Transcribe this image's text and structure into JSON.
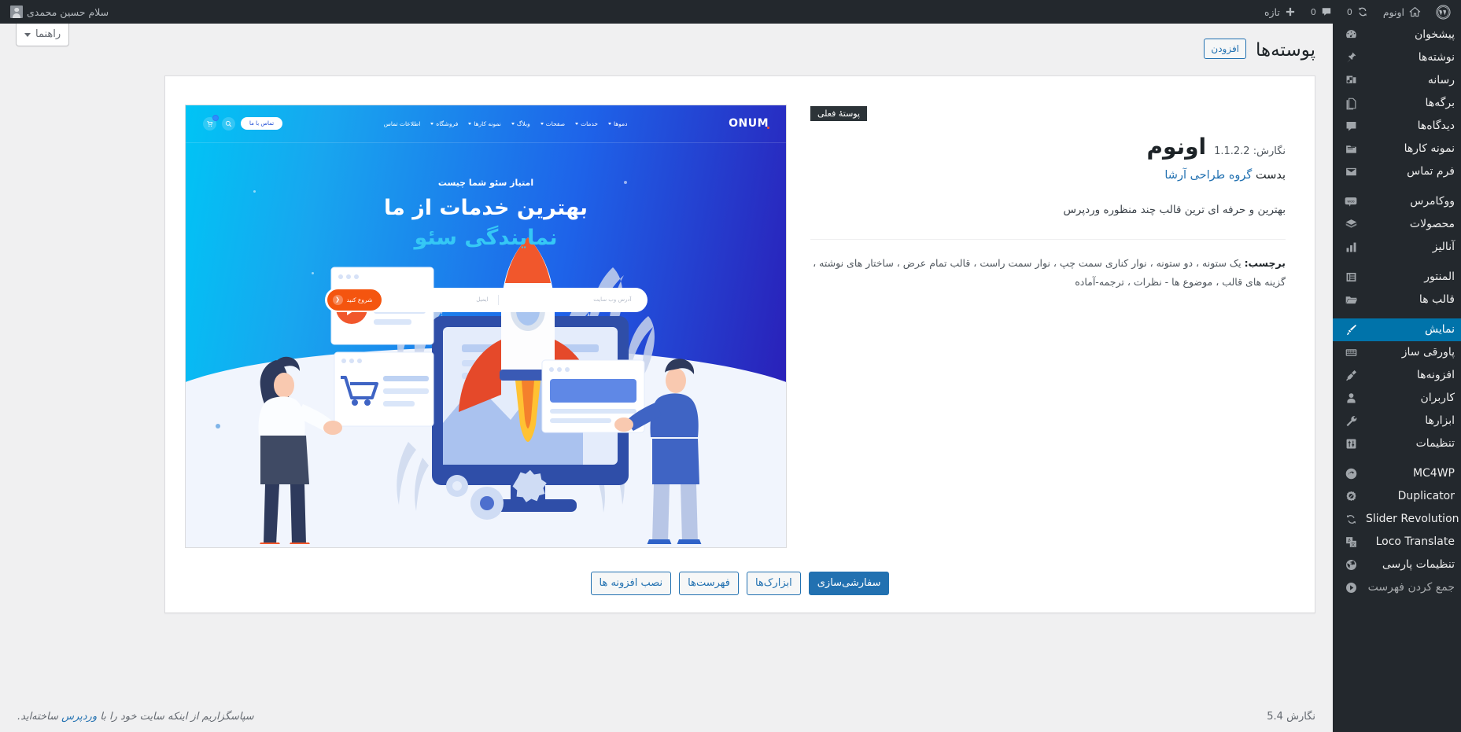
{
  "adminbar": {
    "greeting": "سلام حسین محمدی",
    "wp_logo": "wordpress-logo-icon",
    "site_name": "اونوم",
    "updates_count": "0",
    "comments_count": "0",
    "new_label": "تازه"
  },
  "sidebar": {
    "items": [
      {
        "label": "پیشخوان",
        "icon": "dashboard-icon",
        "current": false
      },
      {
        "label": "نوشته‌ها",
        "icon": "pin-icon",
        "current": false
      },
      {
        "label": "رسانه",
        "icon": "media-icon",
        "current": false
      },
      {
        "label": "برگه‌ها",
        "icon": "pages-icon",
        "current": false
      },
      {
        "label": "دیدگاه‌ها",
        "icon": "comments-icon",
        "current": false
      },
      {
        "label": "نمونه کارها",
        "icon": "portfolio-icon",
        "current": false
      },
      {
        "label": "فرم تماس",
        "icon": "envelope-icon",
        "current": false
      },
      {
        "sep": true
      },
      {
        "label": "ووکامرس",
        "icon": "woocommerce-icon",
        "current": false
      },
      {
        "label": "محصولات",
        "icon": "products-box-icon",
        "current": false
      },
      {
        "label": "آنالیز",
        "icon": "chart-bars-icon",
        "current": false
      },
      {
        "sep": true
      },
      {
        "label": "المنتور",
        "icon": "elementor-icon",
        "current": false
      },
      {
        "label": "قالب ها",
        "icon": "folder-icon",
        "current": false
      },
      {
        "sep": true
      },
      {
        "label": "نمایش",
        "icon": "appearance-brush-icon",
        "current": true
      },
      {
        "label": "پاورقی ساز",
        "icon": "footer-builder-icon",
        "current": false
      },
      {
        "label": "افزونه‌ها",
        "icon": "plugin-icon",
        "current": false
      },
      {
        "label": "کاربران",
        "icon": "users-icon",
        "current": false
      },
      {
        "label": "ابزارها",
        "icon": "tools-wrench-icon",
        "current": false
      },
      {
        "label": "تنظیمات",
        "icon": "settings-sliders-icon",
        "current": false
      },
      {
        "sep": true
      },
      {
        "label": "MC4WP",
        "icon": "mailchimp-icon",
        "current": false
      },
      {
        "label": "Duplicator",
        "icon": "duplicator-icon",
        "current": false
      },
      {
        "label": "Slider Revolution",
        "icon": "slider-revolution-icon",
        "current": false
      },
      {
        "label": "Loco Translate",
        "icon": "loco-translate-icon",
        "current": false
      },
      {
        "label": "تنظیمات پارسی",
        "icon": "globe-icon",
        "current": false
      },
      {
        "label": "جمع کردن فهرست",
        "icon": "collapse-icon",
        "current": false,
        "collapse": true
      }
    ]
  },
  "screen_meta": {
    "help_label": "راهنما"
  },
  "page": {
    "title": "پوسته‌ها",
    "add_new_label": "افزودن"
  },
  "theme": {
    "current_badge": "پوستهٔ فعلی",
    "name": "اونوم",
    "version_label": "نگارش: 1.1.2.2",
    "author_prefix": "بدست",
    "author_name": "گروه طراحی آرشا",
    "description": "بهترین و حرفه ای ترین قالب چند منظوره وردپرس",
    "tags_label": "برچسب:",
    "tags_value": "یک ستونه ، دو ستونه ، نوار کناری سمت چپ ، نوار سمت راست ، قالب تمام عرض ، ساختار های نوشته ، گزینه های قالب ، موضوع ها - نظرات ، ترجمه-آماده",
    "actions": [
      {
        "label": "سفارشی‌سازی",
        "primary": true
      },
      {
        "label": "ابزارک‌ها",
        "primary": false
      },
      {
        "label": "فهرست‌ها",
        "primary": false
      },
      {
        "label": "نصب افزونه ها",
        "primary": false
      }
    ]
  },
  "screenshot": {
    "logo": "ONUM",
    "nav_items": [
      "دموها",
      "خدمات",
      "صفحات",
      "وبلاگ",
      "نمونه کارها",
      "فروشگاه",
      "اطلاعات تماس"
    ],
    "contact_button": "تماس با ما",
    "search_icon": "search-icon",
    "cart_icon": "cart-icon",
    "cart_badge": "0",
    "eyebrow": "امتیاز سئو شما چیست",
    "headline_line1": "بهترین خدمات از ما",
    "headline_line2": "نمایندگی سئو",
    "field_website_placeholder": "آدرس وب سایت",
    "field_email_placeholder": "ایمیل",
    "cta_label": "شروع کنید"
  },
  "footer": {
    "thanks_prefix": "سپاسگزاریم از اینکه سایت خود را با",
    "thanks_link": "وردپرس",
    "thanks_suffix": "ساخته‌اید.",
    "version": "نگارش 5.4"
  },
  "colors": {
    "admin_bg": "#23282d",
    "accent": "#2271b1",
    "current_menu": "#0073aa",
    "content_bg": "#f0f0f1"
  }
}
